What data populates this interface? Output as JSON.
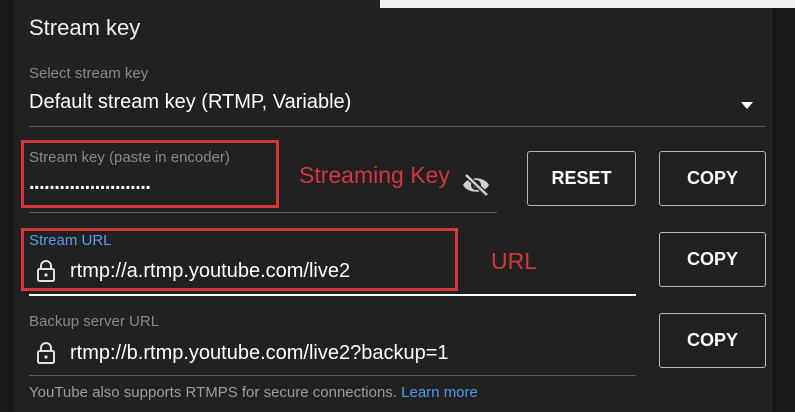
{
  "section_title": "Stream key",
  "select_key": {
    "label": "Select stream key",
    "value": "Default stream key (RTMP, Variable)"
  },
  "stream_key": {
    "label": "Stream key (paste in encoder)",
    "masked_value": "........................",
    "annotation": "Streaming Key",
    "reset_label": "RESET",
    "copy_label": "COPY"
  },
  "stream_url": {
    "label": "Stream URL",
    "value": "rtmp://a.rtmp.youtube.com/live2",
    "annotation": "URL",
    "copy_label": "COPY"
  },
  "backup_url": {
    "label": "Backup server URL",
    "value": "rtmp://b.rtmp.youtube.com/live2?backup=1",
    "copy_label": "COPY"
  },
  "footer": {
    "note": "YouTube also supports RTMPS for secure connections.",
    "link": "Learn more"
  },
  "colors": {
    "background": "#212121",
    "annotation_red": "#d4373c",
    "link_blue": "#4e9cf0",
    "focus_label_blue": "#5b9fe8"
  }
}
